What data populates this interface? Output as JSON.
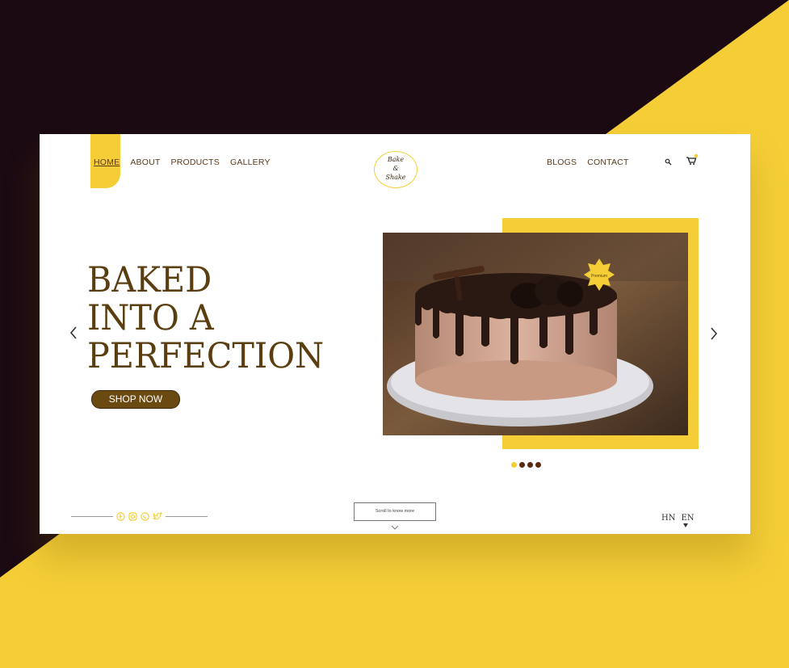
{
  "colors": {
    "dark": "#1b0a12",
    "yellow": "#F5CE37",
    "brown": "#5a3e10"
  },
  "nav": {
    "left": [
      {
        "label": "HOME",
        "active": true
      },
      {
        "label": "ABOUT"
      },
      {
        "label": "PRODUCTS"
      },
      {
        "label": "GALLERY"
      }
    ],
    "right": [
      {
        "label": "BLOGS"
      },
      {
        "label": "CONTACT"
      }
    ]
  },
  "logo": {
    "line1": "Bake",
    "line2": "&",
    "line3": "Shake"
  },
  "hero": {
    "line1": "BAKED",
    "line2": "INTO A",
    "line3": "PERFECTION",
    "cta": "SHOP NOW",
    "badge": "Premium"
  },
  "carousel": {
    "dots": 4,
    "active_index": 0
  },
  "footer": {
    "scroll_label": "Scroll to know more",
    "languages": [
      "HN",
      "EN"
    ],
    "social_icons": [
      "facebook-icon",
      "instagram-icon",
      "whatsapp-icon",
      "twitter-icon"
    ]
  }
}
